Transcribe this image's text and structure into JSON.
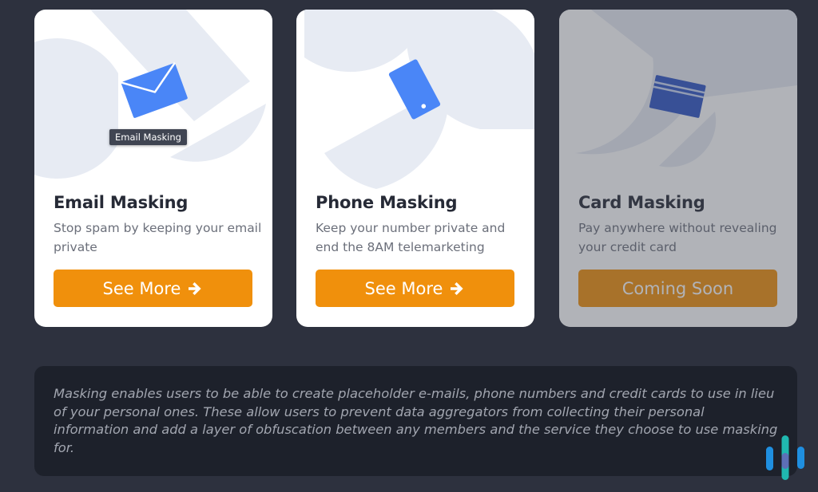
{
  "cards": [
    {
      "title": "Email Masking",
      "description": "Stop spam by keeping your email private",
      "button_label": "See More",
      "button_icon": "arrow-right-icon",
      "illustration_icon": "envelope-icon",
      "enabled": true
    },
    {
      "title": "Phone Masking",
      "description": "Keep your number private and end the 8AM telemarketing",
      "button_label": "See More",
      "button_icon": "arrow-right-icon",
      "illustration_icon": "phone-icon",
      "enabled": true
    },
    {
      "title": "Card Masking",
      "description": "Pay anywhere without revealing your credit card",
      "button_label": "Coming Soon",
      "illustration_icon": "credit-card-icon",
      "enabled": false
    }
  ],
  "tooltip": {
    "text": "Email Masking"
  },
  "info": {
    "text": "Masking enables users to be able to create placeholder e-mails, phone numbers and credit cards to use in lieu of your personal ones. These allow users to prevent data aggregators from collecting their personal information and add a layer of obfuscation between any members and the service they choose to use masking for."
  },
  "brand_logo": {
    "icon": "brand-logo-icon"
  },
  "colors": {
    "page_background": "#2d313e",
    "card_background": "#ffffff",
    "button_orange": "#f0900c",
    "icon_blue": "#4a86f7",
    "card_icon_blue": "#2f55c4",
    "info_background": "#1d212b",
    "decor_shapes": "#e7ebf3"
  }
}
